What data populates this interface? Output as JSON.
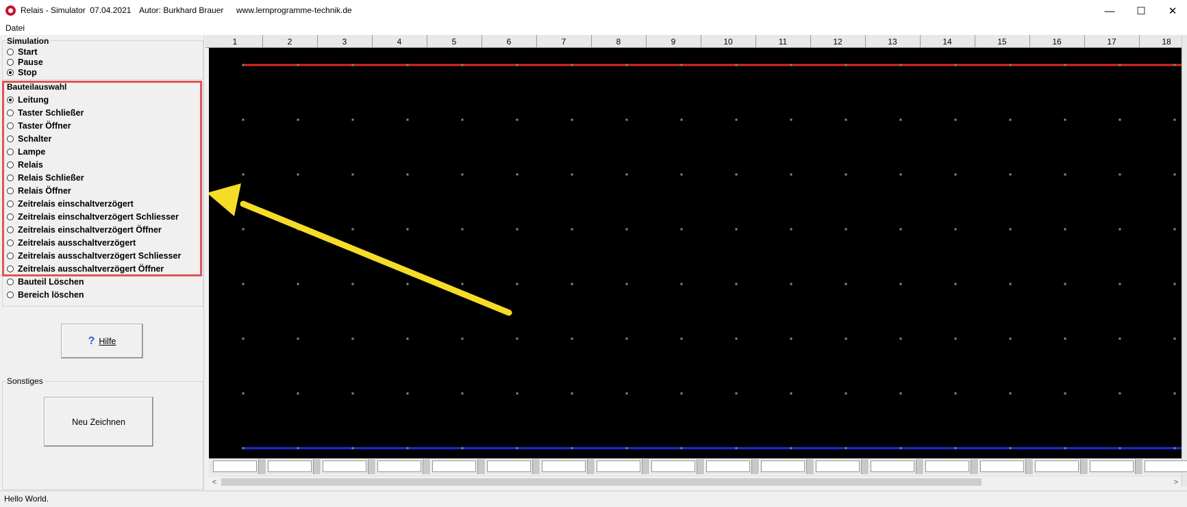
{
  "window": {
    "title": "Relais - Simulator  07.04.2021",
    "author": "Autor: Burkhard Brauer",
    "website": "www.lernprogramme-technik.de",
    "minimize_icon": "—",
    "maximize_icon": "☐",
    "close_icon": "✕"
  },
  "menu": {
    "datei": "Datei"
  },
  "simulation": {
    "caption": "Simulation",
    "options": [
      {
        "label": "Start",
        "checked": false
      },
      {
        "label": "Pause",
        "checked": false
      },
      {
        "label": "Stop",
        "checked": true
      }
    ]
  },
  "bauteilauswahl": {
    "caption": "Bauteilauswahl",
    "options": [
      {
        "label": "Leitung",
        "checked": true
      },
      {
        "label": "Taster Schließer",
        "checked": false
      },
      {
        "label": "Taster Öffner",
        "checked": false
      },
      {
        "label": "Schalter",
        "checked": false
      },
      {
        "label": "Lampe",
        "checked": false
      },
      {
        "label": "Relais",
        "checked": false
      },
      {
        "label": "Relais Schließer",
        "checked": false
      },
      {
        "label": "Relais Öffner",
        "checked": false
      },
      {
        "label": "Zeitrelais einschaltverzögert",
        "checked": false
      },
      {
        "label": "Zeitrelais einschaltverzögert Schliesser",
        "checked": false
      },
      {
        "label": "Zeitrelais einschaltverzögert Öffner",
        "checked": false
      },
      {
        "label": "Zeitrelais ausschaltverzögert",
        "checked": false
      },
      {
        "label": "Zeitrelais ausschaltverzögert Schliesser",
        "checked": false
      },
      {
        "label": "Zeitrelais ausschaltverzögert Öffner",
        "checked": false
      },
      {
        "label": "Bauteil Löschen",
        "checked": false
      },
      {
        "label": "Bereich löschen",
        "checked": false
      }
    ]
  },
  "help_button": {
    "icon": "?",
    "label": "Hilfe"
  },
  "sonstiges": {
    "caption": "Sonstiges",
    "redraw_button": "Neu Zeichnen"
  },
  "ruler": {
    "columns": [
      "1",
      "2",
      "3",
      "4",
      "5",
      "6",
      "7",
      "8",
      "9",
      "10",
      "11",
      "12",
      "13",
      "14",
      "15",
      "16",
      "17",
      "18"
    ]
  },
  "canvas": {
    "background": "#000000",
    "grid_dot_color": "#8a8a8a",
    "top_rail_color": "#e0281e",
    "bottom_rail_color": "#1c2ee0",
    "arrow_color": "#f5dc28"
  },
  "scroll": {
    "left_arrow": "<",
    "right_arrow": ">"
  },
  "status": {
    "text": "Hello World."
  }
}
